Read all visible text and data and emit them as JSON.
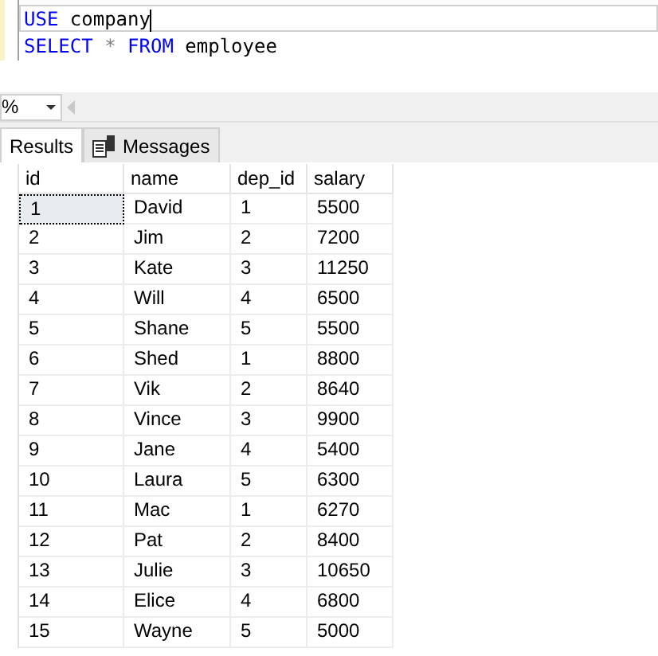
{
  "editor": {
    "lines": [
      {
        "current": true,
        "tokens": [
          {
            "text": "USE",
            "kind": "keyword"
          },
          {
            "text": " company",
            "kind": "plain"
          }
        ]
      },
      {
        "current": false,
        "tokens": [
          {
            "text": "SELECT",
            "kind": "keyword"
          },
          {
            "text": " *",
            "kind": "operator"
          },
          {
            "text": " FROM",
            "kind": "keyword"
          },
          {
            "text": " employee",
            "kind": "plain"
          }
        ]
      }
    ]
  },
  "zoom": {
    "value": "%"
  },
  "tabs": [
    {
      "label": "Results",
      "selected": true,
      "kind": "plain"
    },
    {
      "label": "Messages",
      "selected": false,
      "kind": "messages"
    }
  ],
  "table": {
    "columns": [
      "id",
      "name",
      "dep_id",
      "salary"
    ],
    "rows": [
      {
        "cells": [
          "1",
          "David",
          "1",
          "5500"
        ],
        "selected": true
      },
      {
        "cells": [
          "2",
          "Jim",
          "2",
          "7200"
        ],
        "selected": false
      },
      {
        "cells": [
          "3",
          "Kate",
          "3",
          "11250"
        ],
        "selected": false
      },
      {
        "cells": [
          "4",
          "Will",
          "4",
          "6500"
        ],
        "selected": false
      },
      {
        "cells": [
          "5",
          "Shane",
          "5",
          "5500"
        ],
        "selected": false
      },
      {
        "cells": [
          "6",
          "Shed",
          "1",
          "8800"
        ],
        "selected": false
      },
      {
        "cells": [
          "7",
          "Vik",
          "2",
          "8640"
        ],
        "selected": false
      },
      {
        "cells": [
          "8",
          "Vince",
          "3",
          "9900"
        ],
        "selected": false
      },
      {
        "cells": [
          "9",
          "Jane",
          "4",
          "5400"
        ],
        "selected": false
      },
      {
        "cells": [
          "10",
          "Laura",
          "5",
          "6300"
        ],
        "selected": false
      },
      {
        "cells": [
          "11",
          "Mac",
          "1",
          "6270"
        ],
        "selected": false
      },
      {
        "cells": [
          "12",
          "Pat",
          "2",
          "8400"
        ],
        "selected": false
      },
      {
        "cells": [
          "13",
          "Julie",
          "3",
          "10650"
        ],
        "selected": false
      },
      {
        "cells": [
          "14",
          "Elice",
          "4",
          "6800"
        ],
        "selected": false
      },
      {
        "cells": [
          "15",
          "Wayne",
          "5",
          "5000"
        ],
        "selected": false
      }
    ]
  }
}
